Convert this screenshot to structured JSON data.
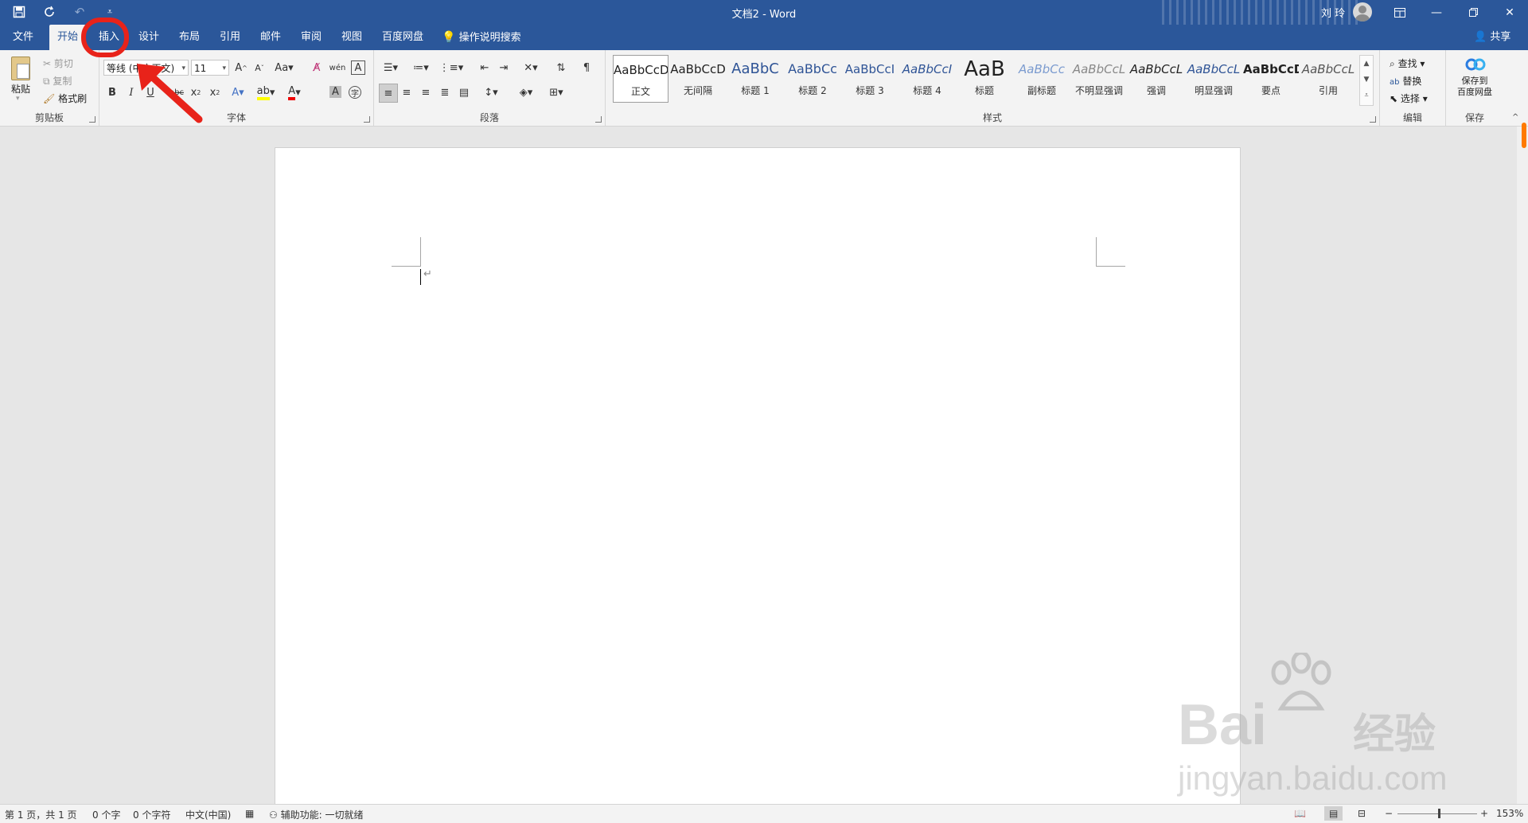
{
  "window": {
    "title": "文档2 - Word",
    "user_name": "刘 玲",
    "qat_icons": [
      "save-icon",
      "autosave-icon",
      "undo-icon",
      "customize-icon"
    ]
  },
  "tabs": [
    {
      "label": "文件"
    },
    {
      "label": "开始",
      "active": true
    },
    {
      "label": "插入"
    },
    {
      "label": "设计"
    },
    {
      "label": "布局"
    },
    {
      "label": "引用"
    },
    {
      "label": "邮件"
    },
    {
      "label": "审阅"
    },
    {
      "label": "视图"
    },
    {
      "label": "百度网盘"
    }
  ],
  "tellme": "操作说明搜索",
  "share": "共享",
  "clipboard": {
    "paste": "粘贴",
    "cut": "剪切",
    "copy": "复制",
    "format_painter": "格式刷",
    "group_label": "剪贴板"
  },
  "font": {
    "family": "等线 (中文正文)",
    "size": "11",
    "group_label": "字体"
  },
  "paragraph": {
    "group_label": "段落"
  },
  "styles": {
    "group_label": "样式",
    "items": [
      {
        "sample": "AaBbCcD",
        "name": "正文",
        "selected": true
      },
      {
        "sample": "AaBbCcD",
        "name": "无间隔"
      },
      {
        "sample": "AaBbC",
        "name": "标题 1"
      },
      {
        "sample": "AaBbCc",
        "name": "标题 2"
      },
      {
        "sample": "AaBbCcI",
        "name": "标题 3"
      },
      {
        "sample": "AaBbCcI",
        "name": "标题 4"
      },
      {
        "sample": "AaB",
        "name": "标题"
      },
      {
        "sample": "AaBbCc",
        "name": "副标题"
      },
      {
        "sample": "AaBbCcL",
        "name": "不明显强调"
      },
      {
        "sample": "AaBbCcL",
        "name": "强调"
      },
      {
        "sample": "AaBbCcL",
        "name": "明显强调"
      },
      {
        "sample": "AaBbCcD",
        "name": "要点"
      },
      {
        "sample": "AaBbCcL",
        "name": "引用"
      }
    ]
  },
  "editing": {
    "find": "查找",
    "replace": "替换",
    "select": "选择",
    "group_label": "编辑"
  },
  "save_group": {
    "button": "保存到\n百度网盘",
    "group_label": "保存"
  },
  "status": {
    "page": "第 1 页，共 1 页",
    "words": "0 个字",
    "chars": "0 个字符",
    "language": "中文(中国)",
    "accessibility": "辅助功能: 一切就绪",
    "zoom": "153%"
  },
  "watermark": {
    "brand": "Bai",
    "brand_cn": "经验",
    "url": "jingyan.baidu.com"
  },
  "colors": {
    "accent": "#2b579a",
    "annotation": "#e8231a"
  }
}
